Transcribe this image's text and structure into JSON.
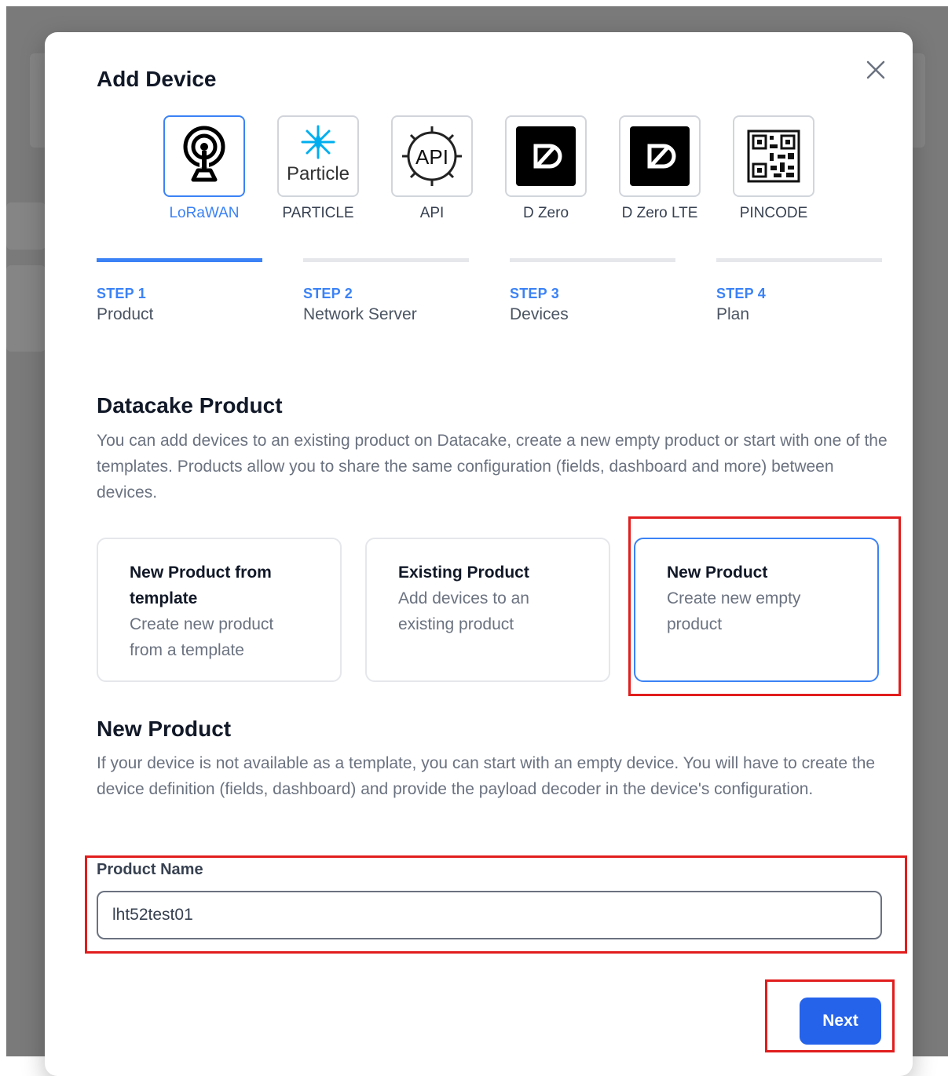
{
  "dialog": {
    "title": "Add Device"
  },
  "device_types": [
    {
      "label": "LoRaWAN",
      "icon": "antenna-icon",
      "active": true
    },
    {
      "label": "PARTICLE",
      "icon": "particle-logo-icon",
      "logo_text": "Particle"
    },
    {
      "label": "API",
      "icon": "api-gear-icon",
      "logo_text": "API"
    },
    {
      "label": "D Zero",
      "icon": "d-zero-logo-icon"
    },
    {
      "label": "D Zero LTE",
      "icon": "d-zero-lte-logo-icon"
    },
    {
      "label": "PINCODE",
      "icon": "qr-code-icon"
    }
  ],
  "steps": [
    {
      "number": "STEP 1",
      "name": "Product",
      "active": true
    },
    {
      "number": "STEP 2",
      "name": "Network Server"
    },
    {
      "number": "STEP 3",
      "name": "Devices"
    },
    {
      "number": "STEP 4",
      "name": "Plan"
    }
  ],
  "product_section": {
    "heading": "Datacake Product",
    "description": "You can add devices to an existing product on Datacake, create a new empty product or start with one of the templates. Products allow you to share the same configuration (fields, dashboard and more) between devices."
  },
  "options": [
    {
      "title": "New Product from template",
      "description": "Create new product from a template"
    },
    {
      "title": "Existing Product",
      "description": "Add devices to an existing product"
    },
    {
      "title": "New Product",
      "description": "Create new empty product",
      "selected": true
    }
  ],
  "new_product": {
    "heading": "New Product",
    "description": "If your device is not available as a template, you can start with an empty device. You will have to create the device definition (fields, dashboard) and provide the payload decoder in the device's configuration.",
    "field_label": "Product Name",
    "field_value": "lht52test01"
  },
  "actions": {
    "next_label": "Next"
  },
  "colors": {
    "accent": "#3b82f6",
    "primary_button": "#2563eb",
    "highlight": "#e11d1d"
  }
}
